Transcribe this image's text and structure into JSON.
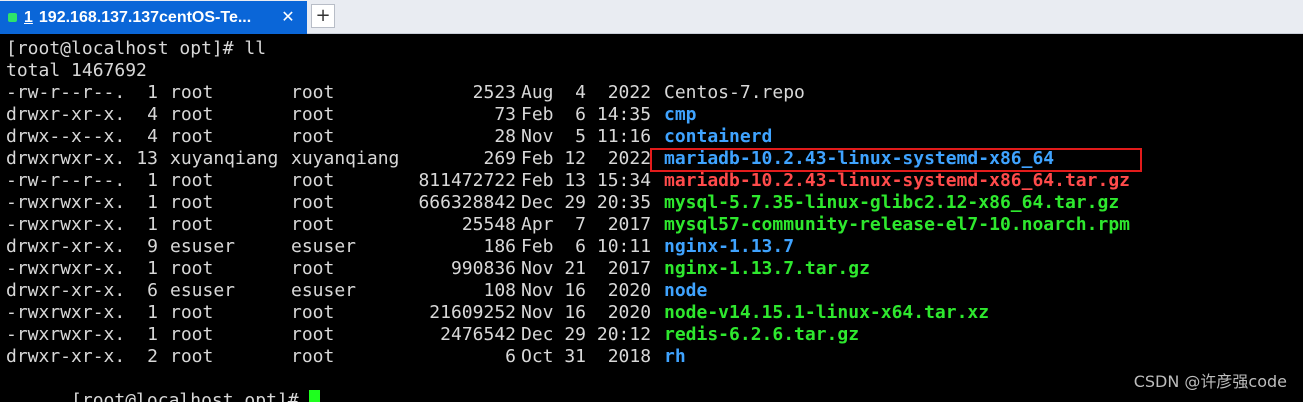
{
  "tab": {
    "index": "1",
    "title": "192.168.137.137centOS-Te...",
    "close_glyph": "✕",
    "add_glyph": "+",
    "status_color": "#2ee36a"
  },
  "terminal": {
    "prompt1": "[root@localhost opt]# ll",
    "total": "total 1467692",
    "rows": [
      {
        "perm": "-rw-r--r--.",
        "links": "1",
        "owner": "root",
        "group": "root",
        "size": "2523",
        "date": "Aug  4  2022",
        "name": "Centos-7.repo",
        "kind": "plain"
      },
      {
        "perm": "drwxr-xr-x.",
        "links": "4",
        "owner": "root",
        "group": "root",
        "size": "73",
        "date": "Feb  6 14:35",
        "name": "cmp",
        "kind": "dir"
      },
      {
        "perm": "drwx--x--x.",
        "links": "4",
        "owner": "root",
        "group": "root",
        "size": "28",
        "date": "Nov  5 11:16",
        "name": "containerd",
        "kind": "dir"
      },
      {
        "perm": "drwxrwxr-x.",
        "links": "13",
        "owner": "xuyanqiang",
        "group": "xuyanqiang",
        "size": "269",
        "date": "Feb 12  2022",
        "name": "mariadb-10.2.43-linux-systemd-x86_64",
        "kind": "dir"
      },
      {
        "perm": "-rw-r--r--.",
        "links": "1",
        "owner": "root",
        "group": "root",
        "size": "811472722",
        "date": "Feb 13 15:34",
        "name": "mariadb-10.2.43-linux-systemd-x86_64.tar.gz",
        "kind": "arch"
      },
      {
        "perm": "-rwxrwxr-x.",
        "links": "1",
        "owner": "root",
        "group": "root",
        "size": "666328842",
        "date": "Dec 29 20:35",
        "name": "mysql-5.7.35-linux-glibc2.12-x86_64.tar.gz",
        "kind": "exe"
      },
      {
        "perm": "-rwxrwxr-x.",
        "links": "1",
        "owner": "root",
        "group": "root",
        "size": "25548",
        "date": "Apr  7  2017",
        "name": "mysql57-community-release-el7-10.noarch.rpm",
        "kind": "exe"
      },
      {
        "perm": "drwxr-xr-x.",
        "links": "9",
        "owner": "esuser",
        "group": "esuser",
        "size": "186",
        "date": "Feb  6 10:11",
        "name": "nginx-1.13.7",
        "kind": "dir"
      },
      {
        "perm": "-rwxrwxr-x.",
        "links": "1",
        "owner": "root",
        "group": "root",
        "size": "990836",
        "date": "Nov 21  2017",
        "name": "nginx-1.13.7.tar.gz",
        "kind": "exe"
      },
      {
        "perm": "drwxr-xr-x.",
        "links": "6",
        "owner": "esuser",
        "group": "esuser",
        "size": "108",
        "date": "Nov 16  2020",
        "name": "node",
        "kind": "dir"
      },
      {
        "perm": "-rwxrwxr-x.",
        "links": "1",
        "owner": "root",
        "group": "root",
        "size": "21609252",
        "date": "Nov 16  2020",
        "name": "node-v14.15.1-linux-x64.tar.xz",
        "kind": "exe"
      },
      {
        "perm": "-rwxrwxr-x.",
        "links": "1",
        "owner": "root",
        "group": "root",
        "size": "2476542",
        "date": "Dec 29 20:12",
        "name": "redis-6.2.6.tar.gz",
        "kind": "exe"
      },
      {
        "perm": "drwxr-xr-x.",
        "links": "2",
        "owner": "root",
        "group": "root",
        "size": "6",
        "date": "Oct 31  2018",
        "name": "rh",
        "kind": "dir"
      }
    ],
    "prompt2": "[root@localhost opt]# ",
    "colors": {
      "directory": "#3fa3ff",
      "executable": "#2ee82e",
      "archive": "#ff4b4b",
      "highlight_box": "#e21b1b",
      "cursor": "#1eff1e"
    }
  },
  "watermark": "CSDN @许彦强code"
}
